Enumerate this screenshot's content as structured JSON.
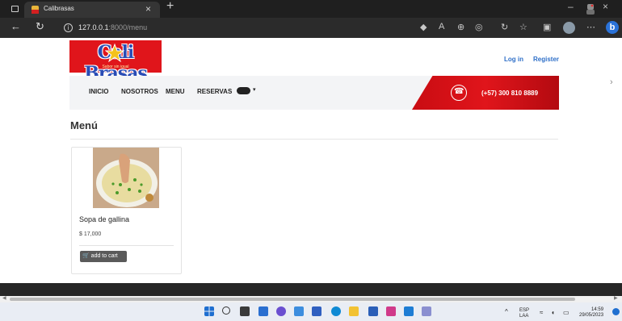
{
  "browser": {
    "tab_title": "Calibrasas",
    "tab_close": "×",
    "new_tab": "+",
    "url_host": "127.0.0.1",
    "url_path": ":8000/menu",
    "window_minimize": "–",
    "window_close": "×"
  },
  "site": {
    "logo_text": "Cali Brasas",
    "logo_tagline": "Sabor sin igual",
    "auth": {
      "login": "Log in",
      "register": "Register"
    },
    "nav": [
      "INICIO",
      "NOSOTROS",
      "MENU",
      "RESERVAS"
    ],
    "nav_dropdown_caret": "▾",
    "phone": "(+57) 300 810 8889"
  },
  "main": {
    "title": "Menú",
    "products": [
      {
        "name": "Sopa de gallina",
        "price": "$ 17,000",
        "button": "add to cart"
      }
    ]
  },
  "taskbar": {
    "lang_top": "ESP",
    "lang_bottom": "LAA",
    "time": "14:59",
    "date": "29/05/2023"
  },
  "colors": {
    "brand_red": "#e0151b",
    "link_blue": "#2e6fc8",
    "dark_bar": "#262626"
  }
}
